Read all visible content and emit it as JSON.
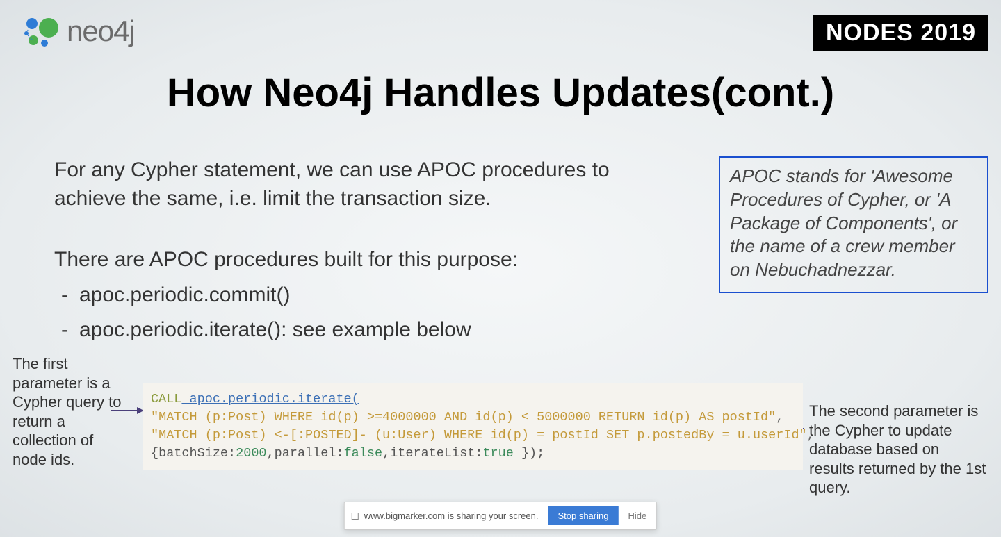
{
  "header": {
    "logo_text": "neo4j",
    "badge": "NODES 2019"
  },
  "title": "How Neo4j Handles Updates(cont.)",
  "body": {
    "p1": "For any Cypher statement, we can use APOC procedures to achieve the same, i.e. limit the transaction size.",
    "p2": "There are APOC procedures built for this purpose:",
    "li1": "apoc.periodic.commit()",
    "li2": "apoc.periodic.iterate(): see example below"
  },
  "apoc_box": "APOC stands for 'Awesome Procedures of Cypher, or 'A Package of Components', or the name of a crew member on Nebuchadnezzar.",
  "annotations": {
    "left": "The first parameter is a Cypher query to return a collection of node ids.",
    "right": "The second parameter is the Cypher to update database based on results returned by the 1st query."
  },
  "code": {
    "call": "CALL",
    "fn": " apoc.periodic.iterate(",
    "line2": "\"MATCH (p:Post) WHERE id(p) >=4000000 AND id(p) < 5000000 RETURN id(p) AS postId\"",
    "comma": ",",
    "line3": "\"MATCH (p:Post) <-[:POSTED]- (u:User) WHERE id(p) = postId SET p.postedBy = u.userId\"",
    "line4a": "{batchSize:",
    "n1": "2000",
    "line4b": ",parallel:",
    "b1": "false",
    "line4c": ",iterateList:",
    "b2": "true",
    "line4d": " });"
  },
  "share": {
    "message": "www.bigmarker.com is sharing your screen.",
    "stop": "Stop sharing",
    "hide": "Hide"
  }
}
